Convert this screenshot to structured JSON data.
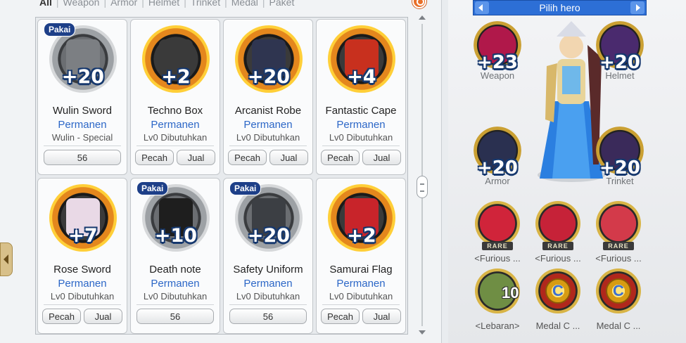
{
  "tabs": [
    "All",
    "Weapon",
    "Armor",
    "Helmet",
    "Trinket",
    "Medal",
    "Paket"
  ],
  "active_tab": "All",
  "items": [
    {
      "name": "Wulin Sword",
      "status": "Permanen",
      "requirement": "Wulin - Special",
      "plus": "+20",
      "pakai": "Pakai",
      "buttons": [
        "56"
      ],
      "icon": "sword-icon",
      "ring": "grey",
      "art": "#7c7f83"
    },
    {
      "name": "Techno Box",
      "status": "Permanen",
      "requirement": "Lv0 Dibutuhkan",
      "plus": "+2",
      "pakai": "",
      "buttons": [
        "Pecah",
        "Jual"
      ],
      "icon": "box-icon",
      "ring": "#e4871d",
      "art": "#3a3a3a"
    },
    {
      "name": "Arcanist Robe",
      "status": "Permanen",
      "requirement": "Lv0 Dibutuhkan",
      "plus": "+20",
      "pakai": "",
      "buttons": [
        "Pecah",
        "Jual"
      ],
      "icon": "robe-icon",
      "ring": "#e4871d",
      "art": "#2f3550"
    },
    {
      "name": "Fantastic Cape",
      "status": "Permanen",
      "requirement": "Lv0 Dibutuhkan",
      "plus": "+4",
      "pakai": "",
      "buttons": [
        "Pecah",
        "Jual"
      ],
      "icon": "cape-icon",
      "ring": "#e4871d",
      "art": "#c8301e"
    },
    {
      "name": "Rose Sword",
      "status": "Permanen",
      "requirement": "Lv0 Dibutuhkan",
      "plus": "+7",
      "pakai": "",
      "buttons": [
        "Pecah",
        "Jual"
      ],
      "icon": "rose-sword-icon",
      "ring": "#e4871d",
      "art": "#e9d9e6"
    },
    {
      "name": "Death note",
      "status": "Permanen",
      "requirement": "Lv0 Dibutuhkan",
      "plus": "+10",
      "pakai": "Pakai",
      "buttons": [
        "56"
      ],
      "icon": "notebook-icon",
      "ring": "grey",
      "art": "#1e1e1e"
    },
    {
      "name": "Safety Uniform",
      "status": "Permanen",
      "requirement": "Lv0 Dibutuhkan",
      "plus": "+20",
      "pakai": "Pakai",
      "buttons": [
        "56"
      ],
      "icon": "uniform-icon",
      "ring": "grey",
      "art": "#3c3f44"
    },
    {
      "name": "Samurai Flag",
      "status": "Permanen",
      "requirement": "Lv0 Dibutuhkan",
      "plus": "+2",
      "pakai": "",
      "buttons": [
        "Pecah",
        "Jual"
      ],
      "icon": "flag-icon",
      "ring": "#e4871d",
      "art": "#c8242a"
    }
  ],
  "hero": {
    "title": "Pilih hero",
    "slots": [
      {
        "label": "Weapon",
        "plus": "+23",
        "color": "#b0184a"
      },
      {
        "label": "Helmet",
        "plus": "+20",
        "color": "#4a2a6e"
      },
      {
        "label": "Armor",
        "plus": "+20",
        "color": "#2a3050"
      },
      {
        "label": "Trinket",
        "plus": "+20",
        "color": "#3a2a5a"
      }
    ],
    "medals": [
      {
        "label": "<Furious ...",
        "rare": "RARE",
        "color": "#d0243a"
      },
      {
        "label": "<Furious ...",
        "rare": "RARE",
        "color": "#c62238"
      },
      {
        "label": "<Furious ...",
        "rare": "RARE",
        "color": "#d33a4a"
      },
      {
        "label": "<Lebaran>",
        "badge": "10",
        "color": "#6f8e44"
      },
      {
        "label": "Medal C ...",
        "coin": "C",
        "color": "#b0281c"
      },
      {
        "label": "Medal C ...",
        "coin": "C",
        "color": "#b0281c"
      }
    ]
  }
}
